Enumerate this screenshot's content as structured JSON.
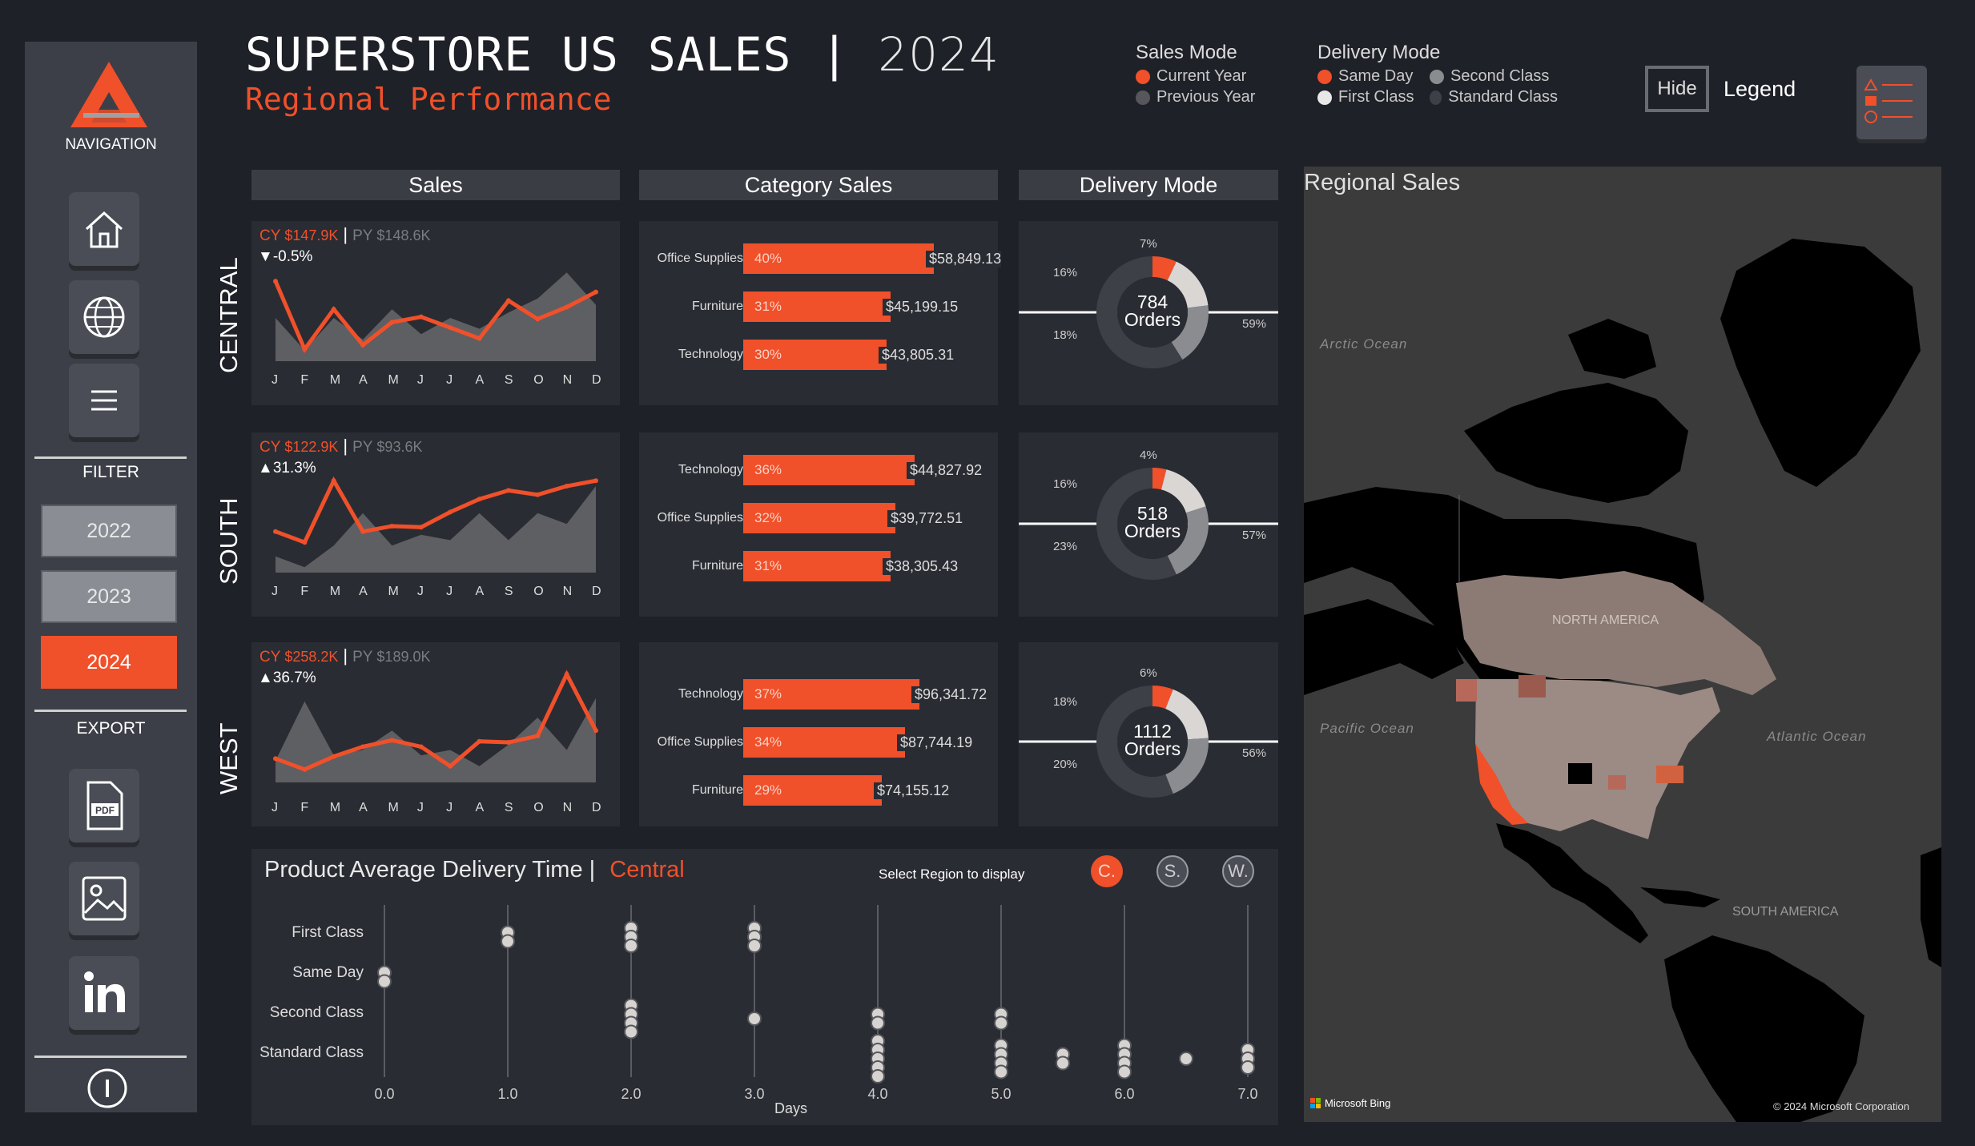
{
  "header": {
    "title": "SUPERSTORE US SALES",
    "divider": "|",
    "year": "2024",
    "subtitle": "Regional Performance"
  },
  "sales_mode": {
    "title": "Sales Mode",
    "items": [
      "Current Year",
      "Previous Year"
    ]
  },
  "delivery_mode_legend": {
    "title": "Delivery Mode",
    "items": [
      "Same Day",
      "Second Class",
      "First Class",
      "Standard Class"
    ]
  },
  "legend_toggle": {
    "button": "Hide",
    "label": "Legend"
  },
  "sidebar": {
    "navigation": "NAVIGATION",
    "filter": "FILTER",
    "years": [
      "2022",
      "2023",
      "2024"
    ],
    "export": "EXPORT",
    "pdf": "PDF"
  },
  "columns": {
    "sales": "Sales",
    "category": "Category Sales",
    "delivery": "Delivery Mode",
    "map": "Regional Sales"
  },
  "months": [
    "J",
    "F",
    "M",
    "A",
    "M",
    "J",
    "J",
    "A",
    "S",
    "O",
    "N",
    "D"
  ],
  "regions": [
    {
      "name": "CENTRAL",
      "cy_label": "CY",
      "cy": "$147.9K",
      "py_label": "PY",
      "py": "$148.6K",
      "change": "-0.5%",
      "direction": "down",
      "cy_series": [
        0.74,
        0.11,
        0.48,
        0.15,
        0.36,
        0.41,
        0.31,
        0.21,
        0.56,
        0.39,
        0.5,
        0.64
      ],
      "py_series": [
        0.4,
        0.1,
        0.4,
        0.2,
        0.48,
        0.25,
        0.4,
        0.3,
        0.45,
        0.58,
        0.82,
        0.52
      ],
      "categories": [
        {
          "name": "Office Supplies",
          "pct": "40%",
          "share": 40,
          "value": "$58,849.13"
        },
        {
          "name": "Furniture",
          "pct": "31%",
          "share": 31,
          "value": "$45,199.15"
        },
        {
          "name": "Technology",
          "pct": "30%",
          "share": 30,
          "value": "$43,805.31"
        }
      ],
      "delivery": {
        "orders": "784",
        "orders_label": "Orders",
        "same_day": "7%",
        "first": "16%",
        "second": "18%",
        "standard": "59%",
        "shares": [
          7,
          16,
          18,
          59
        ]
      }
    },
    {
      "name": "SOUTH",
      "cy_label": "CY",
      "cy": "$122.9K",
      "py_label": "PY",
      "py": "$93.6K",
      "change": "31.3%",
      "direction": "up",
      "cy_series": [
        0.38,
        0.28,
        0.85,
        0.38,
        0.43,
        0.42,
        0.56,
        0.68,
        0.76,
        0.72,
        0.8,
        0.85
      ],
      "py_series": [
        0.15,
        0.05,
        0.25,
        0.55,
        0.25,
        0.35,
        0.3,
        0.55,
        0.3,
        0.55,
        0.45,
        0.8
      ],
      "categories": [
        {
          "name": "Technology",
          "pct": "36%",
          "share": 36,
          "value": "$44,827.92"
        },
        {
          "name": "Office Supplies",
          "pct": "32%",
          "share": 32,
          "value": "$39,772.51"
        },
        {
          "name": "Furniture",
          "pct": "31%",
          "share": 31,
          "value": "$38,305.43"
        }
      ],
      "delivery": {
        "orders": "518",
        "orders_label": "Orders",
        "same_day": "4%",
        "first": "16%",
        "second": "23%",
        "standard": "57%",
        "shares": [
          4,
          16,
          23,
          57
        ]
      }
    },
    {
      "name": "WEST",
      "cy_label": "CY",
      "cy": "$258.2K",
      "py_label": "PY",
      "py": "$189.0K",
      "change": "36.7%",
      "direction": "up",
      "cy_series": [
        0.22,
        0.12,
        0.24,
        0.33,
        0.39,
        0.33,
        0.15,
        0.38,
        0.37,
        0.43,
        1.0,
        0.48
      ],
      "py_series": [
        0.2,
        0.75,
        0.25,
        0.3,
        0.48,
        0.25,
        0.3,
        0.15,
        0.35,
        0.6,
        0.3,
        0.78
      ],
      "categories": [
        {
          "name": "Technology",
          "pct": "37%",
          "share": 37,
          "value": "$96,341.72"
        },
        {
          "name": "Office Supplies",
          "pct": "34%",
          "share": 34,
          "value": "$87,744.19"
        },
        {
          "name": "Furniture",
          "pct": "29%",
          "share": 29,
          "value": "$74,155.12"
        }
      ],
      "delivery": {
        "orders": "1112",
        "orders_label": "Orders",
        "same_day": "6%",
        "first": "18%",
        "second": "20%",
        "standard": "56%",
        "shares": [
          6,
          18,
          20,
          56
        ]
      }
    }
  ],
  "delivery_time": {
    "title": "Product Average Delivery Time |",
    "region": "Central",
    "select_label": "Select Region to display",
    "region_buttons": [
      "C.",
      "S.",
      "W."
    ],
    "rows": [
      "First Class",
      "Same Day",
      "Second Class",
      "Standard Class"
    ],
    "x_ticks": [
      "0.0",
      "1.0",
      "2.0",
      "3.0",
      "4.0",
      "5.0",
      "6.0",
      "7.0"
    ],
    "xlabel": "Days",
    "points": [
      {
        "row": 0,
        "days": [
          1.0,
          1.0,
          2.0,
          2.0,
          2.0,
          3.0,
          3.0,
          3.0
        ]
      },
      {
        "row": 1,
        "days": [
          0.0,
          0.0
        ]
      },
      {
        "row": 2,
        "days": [
          2.0,
          2.0,
          2.0,
          2.0,
          3.0,
          4.0,
          4.0,
          5.0,
          5.0
        ]
      },
      {
        "row": 3,
        "days": [
          4.0,
          4.0,
          4.0,
          4.0,
          4.0,
          5.0,
          5.0,
          5.0,
          5.0,
          5.5,
          5.5,
          6.0,
          6.0,
          6.0,
          6.0,
          6.5,
          7.0,
          7.0,
          7.0
        ]
      }
    ]
  },
  "map": {
    "oceans": [
      "Arctic Ocean",
      "Pacific Ocean",
      "Atlantic Ocean"
    ],
    "continents": [
      "NORTH AMERICA",
      "SOUTH AMERICA"
    ],
    "bing": "Microsoft Bing",
    "copyright": "© 2024 Microsoft Corporation"
  },
  "colors": {
    "accent": "#f0502a",
    "panel": "#2a2c33",
    "bg": "#1f2128",
    "sidebar": "#3c3f47",
    "py_area": "#5e5f63"
  }
}
